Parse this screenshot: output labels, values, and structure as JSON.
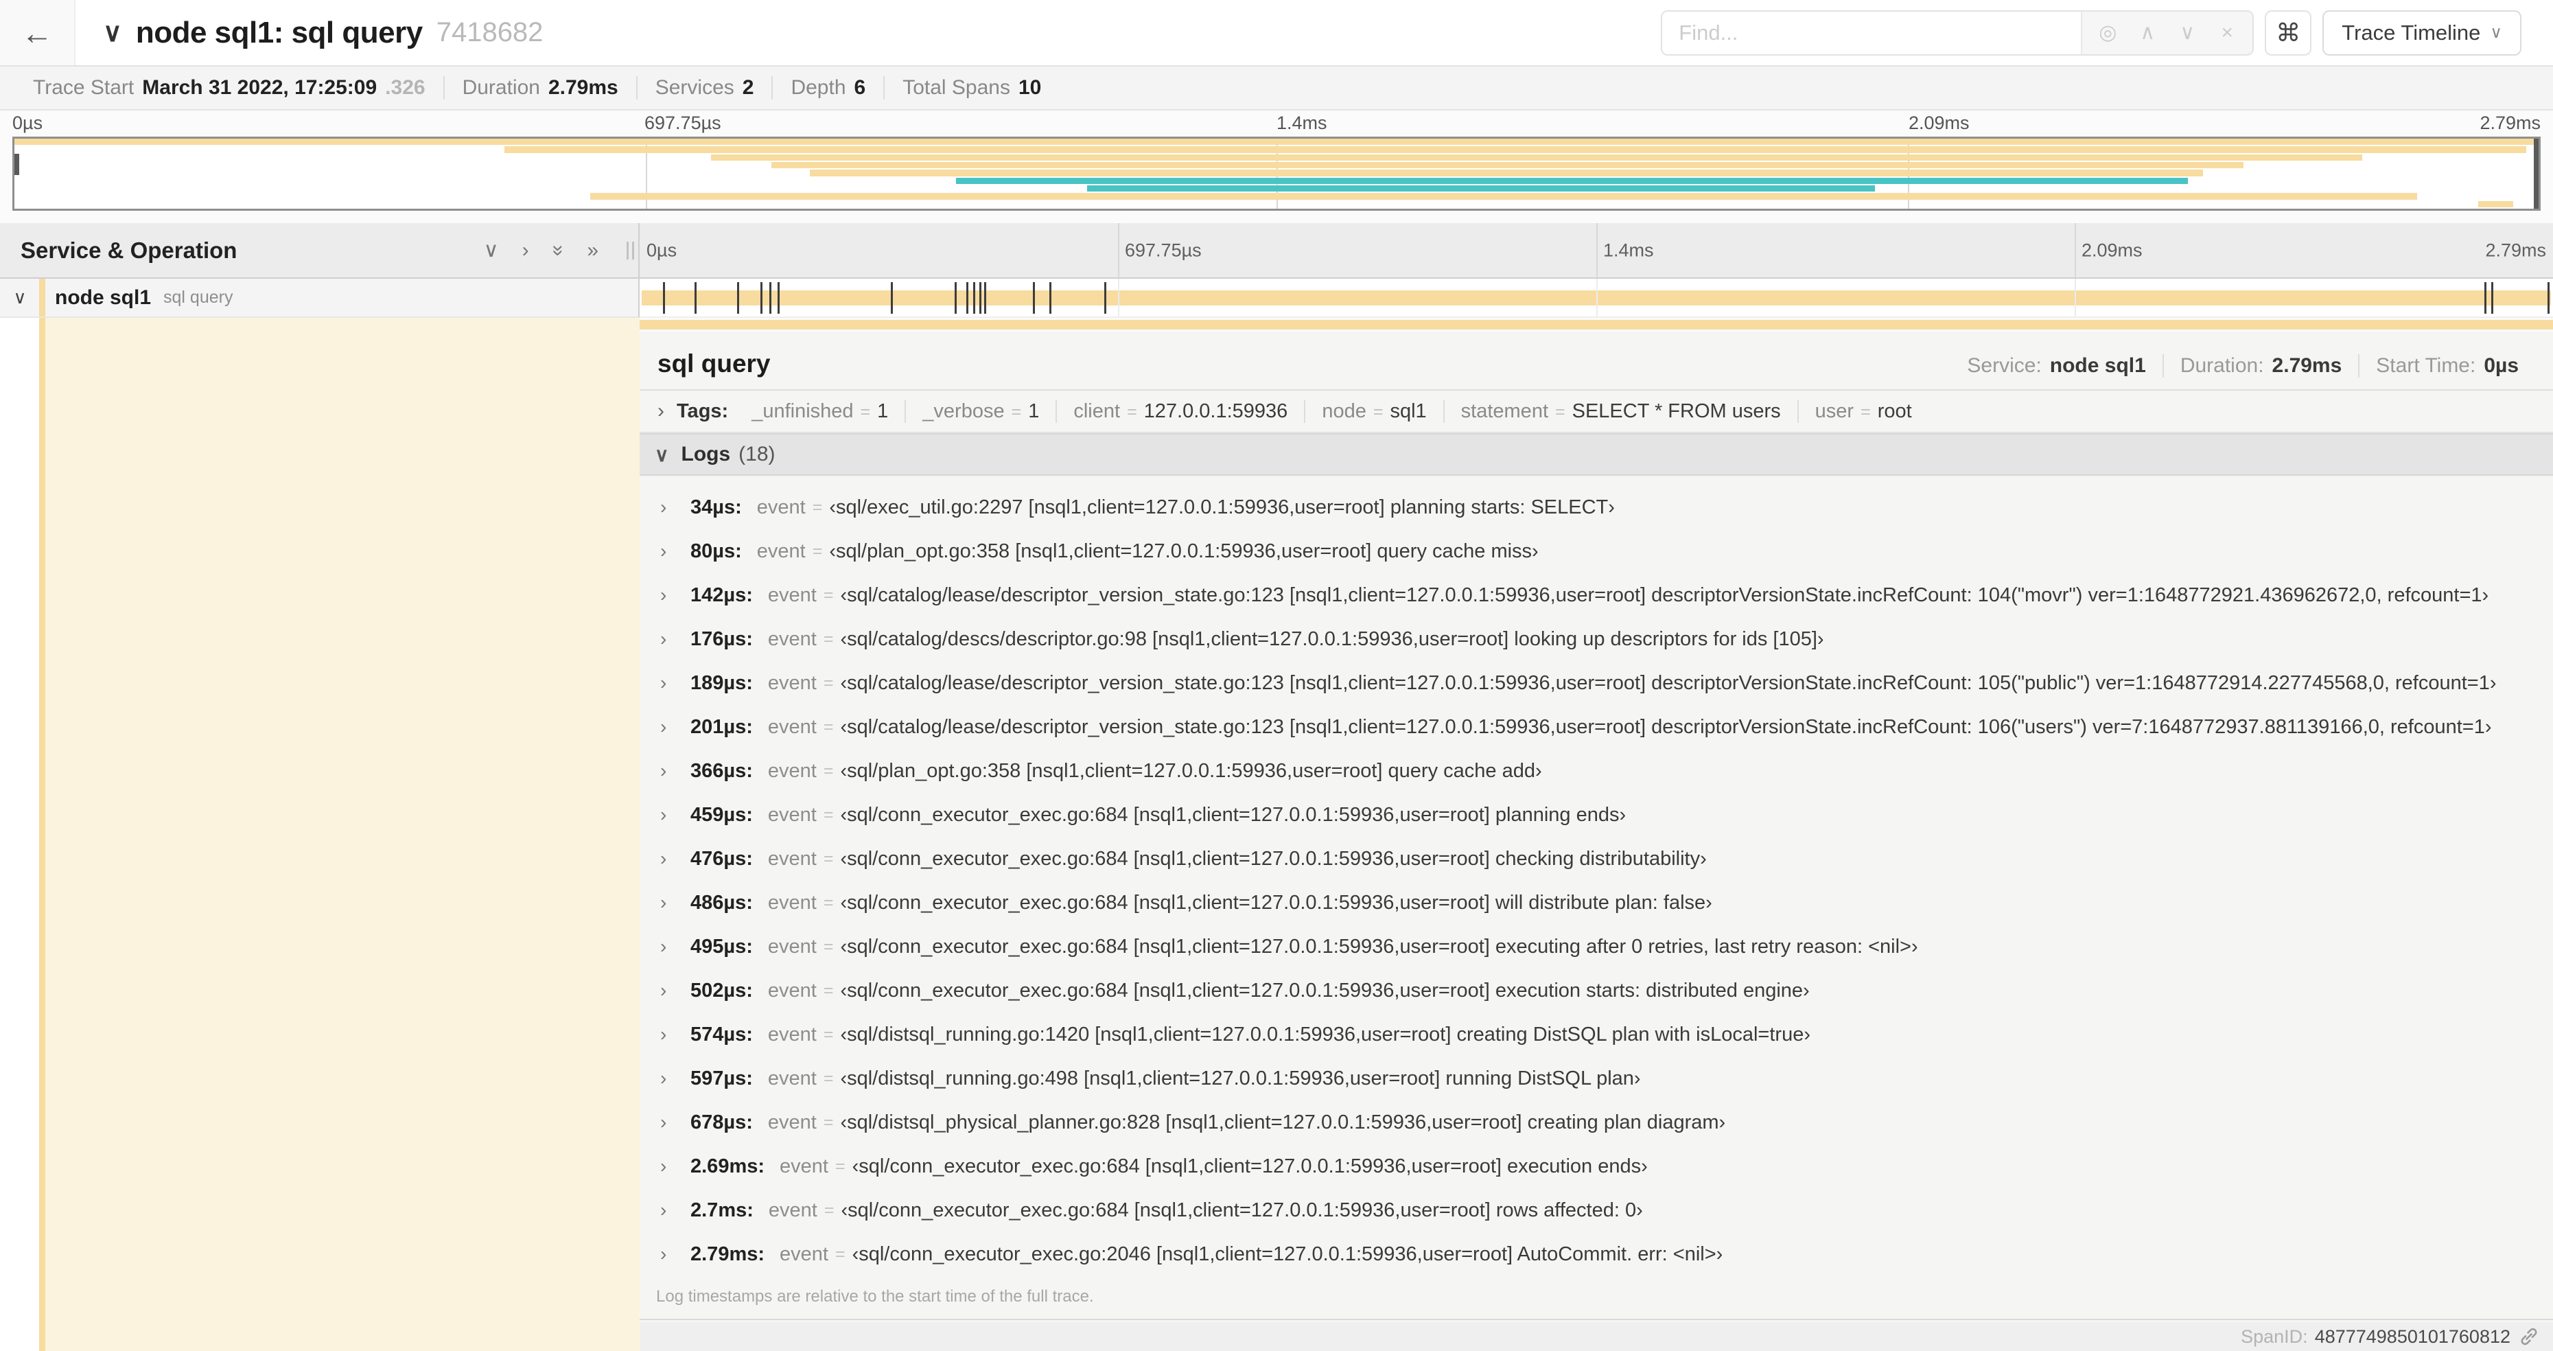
{
  "colors": {
    "tan": "#F7DB9F",
    "teal": "#48C4C4",
    "cream": "#FCF3DE",
    "dark_tick": "#3d3d3d"
  },
  "header": {
    "back_icon": "←",
    "collapse_icon": "∨",
    "title": "node sql1: sql query",
    "trace_id": "7418682",
    "find_placeholder": "Find...",
    "find_buttons": {
      "target": "◎",
      "prev": "∧",
      "next": "∨",
      "clear": "×"
    },
    "shortcuts_icon": "⌘",
    "view_selector": "Trace Timeline",
    "view_selector_chevron": "∨"
  },
  "summary": {
    "items": [
      {
        "label": "Trace Start",
        "value": "March 31 2022, 17:25:09",
        "suffix": ".326"
      },
      {
        "label": "Duration",
        "value": "2.79ms"
      },
      {
        "label": "Services",
        "value": "2"
      },
      {
        "label": "Depth",
        "value": "6"
      },
      {
        "label": "Total Spans",
        "value": "10"
      }
    ]
  },
  "timeline": {
    "ticks": [
      {
        "text": "0µs",
        "pos": 0
      },
      {
        "text": "697.75µs",
        "pos": 0.25
      },
      {
        "text": "1.4ms",
        "pos": 0.5
      },
      {
        "text": "2.09ms",
        "pos": 0.75
      },
      {
        "text": "2.79ms",
        "pos": 1
      }
    ]
  },
  "minimap": {
    "spans": [
      {
        "start": 0.0,
        "end": 1.0,
        "color": "tan"
      },
      {
        "start": 0.194,
        "end": 0.995,
        "color": "tan"
      },
      {
        "start": 0.276,
        "end": 0.93,
        "color": "tan"
      },
      {
        "start": 0.3,
        "end": 0.883,
        "color": "tan"
      },
      {
        "start": 0.315,
        "end": 0.867,
        "color": "tan"
      },
      {
        "start": 0.373,
        "end": 0.861,
        "color": "teal"
      },
      {
        "start": 0.425,
        "end": 0.737,
        "color": "teal"
      },
      {
        "start": 0.228,
        "end": 0.952,
        "color": "tan"
      },
      {
        "start": 0.976,
        "end": 0.99,
        "color": "tan"
      }
    ]
  },
  "span_row": {
    "chevron": "∨",
    "service": "node sql1",
    "operation": "sql query",
    "log_tick_fractions": [
      0.0122,
      0.0287,
      0.0509,
      0.0631,
      0.0677,
      0.072,
      0.1312,
      0.1645,
      0.1706,
      0.1742,
      0.1774,
      0.1799,
      0.2057,
      0.214,
      0.243,
      0.9642,
      0.9677,
      0.997
    ]
  },
  "controls": {
    "title": "Service & Operation",
    "collapse_one": "∨",
    "expand_one": "›",
    "collapse_all": "»",
    "expand_all": "»"
  },
  "detail": {
    "title": "sql query",
    "meta": [
      {
        "label": "Service:",
        "value": "node sql1"
      },
      {
        "label": "Duration:",
        "value": "2.79ms"
      },
      {
        "label": "Start Time:",
        "value": "0µs"
      }
    ],
    "tags_chevron": "›",
    "tags_label": "Tags:",
    "tags": [
      {
        "key": "_unfinished",
        "value": "1"
      },
      {
        "key": "_verbose",
        "value": "1"
      },
      {
        "key": "client",
        "value": "127.0.0.1:59936"
      },
      {
        "key": "node",
        "value": "sql1"
      },
      {
        "key": "statement",
        "value": "SELECT * FROM users"
      },
      {
        "key": "user",
        "value": "root"
      }
    ],
    "logs_chevron": "∨",
    "logs_label": "Logs",
    "logs_count": "(18)",
    "log_field": "event",
    "logs": [
      {
        "time": "34µs:",
        "value": "‹sql/exec_util.go:2297 [nsql1,client=127.0.0.1:59936,user=root] planning starts: SELECT›"
      },
      {
        "time": "80µs:",
        "value": "‹sql/plan_opt.go:358 [nsql1,client=127.0.0.1:59936,user=root] query cache miss›"
      },
      {
        "time": "142µs:",
        "value": "‹sql/catalog/lease/descriptor_version_state.go:123 [nsql1,client=127.0.0.1:59936,user=root] descriptorVersionState.incRefCount: 104(\"movr\") ver=1:1648772921.436962672,0, refcount=1›"
      },
      {
        "time": "176µs:",
        "value": "‹sql/catalog/descs/descriptor.go:98 [nsql1,client=127.0.0.1:59936,user=root] looking up descriptors for ids [105]›"
      },
      {
        "time": "189µs:",
        "value": "‹sql/catalog/lease/descriptor_version_state.go:123 [nsql1,client=127.0.0.1:59936,user=root] descriptorVersionState.incRefCount: 105(\"public\") ver=1:1648772914.227745568,0, refcount=1›"
      },
      {
        "time": "201µs:",
        "value": "‹sql/catalog/lease/descriptor_version_state.go:123 [nsql1,client=127.0.0.1:59936,user=root] descriptorVersionState.incRefCount: 106(\"users\") ver=7:1648772937.881139166,0, refcount=1›"
      },
      {
        "time": "366µs:",
        "value": "‹sql/plan_opt.go:358 [nsql1,client=127.0.0.1:59936,user=root] query cache add›"
      },
      {
        "time": "459µs:",
        "value": "‹sql/conn_executor_exec.go:684 [nsql1,client=127.0.0.1:59936,user=root] planning ends›"
      },
      {
        "time": "476µs:",
        "value": "‹sql/conn_executor_exec.go:684 [nsql1,client=127.0.0.1:59936,user=root] checking distributability›"
      },
      {
        "time": "486µs:",
        "value": "‹sql/conn_executor_exec.go:684 [nsql1,client=127.0.0.1:59936,user=root] will distribute plan: false›"
      },
      {
        "time": "495µs:",
        "value": "‹sql/conn_executor_exec.go:684 [nsql1,client=127.0.0.1:59936,user=root] executing after 0 retries, last retry reason: <nil>›"
      },
      {
        "time": "502µs:",
        "value": "‹sql/conn_executor_exec.go:684 [nsql1,client=127.0.0.1:59936,user=root] execution starts: distributed engine›"
      },
      {
        "time": "574µs:",
        "value": "‹sql/distsql_running.go:1420 [nsql1,client=127.0.0.1:59936,user=root] creating DistSQL plan with isLocal=true›"
      },
      {
        "time": "597µs:",
        "value": "‹sql/distsql_running.go:498 [nsql1,client=127.0.0.1:59936,user=root] running DistSQL plan›"
      },
      {
        "time": "678µs:",
        "value": "‹sql/distsql_physical_planner.go:828 [nsql1,client=127.0.0.1:59936,user=root] creating plan diagram›"
      },
      {
        "time": "2.69ms:",
        "value": "‹sql/conn_executor_exec.go:684 [nsql1,client=127.0.0.1:59936,user=root] execution ends›"
      },
      {
        "time": "2.7ms:",
        "value": "‹sql/conn_executor_exec.go:684 [nsql1,client=127.0.0.1:59936,user=root] rows affected: 0›"
      },
      {
        "time": "2.79ms:",
        "value": "‹sql/conn_executor_exec.go:2046 [nsql1,client=127.0.0.1:59936,user=root] AutoCommit. err: <nil>›"
      }
    ],
    "logs_note": "Log timestamps are relative to the start time of the full trace.",
    "span_id_label": "SpanID:",
    "span_id": "4877749850101760812"
  }
}
